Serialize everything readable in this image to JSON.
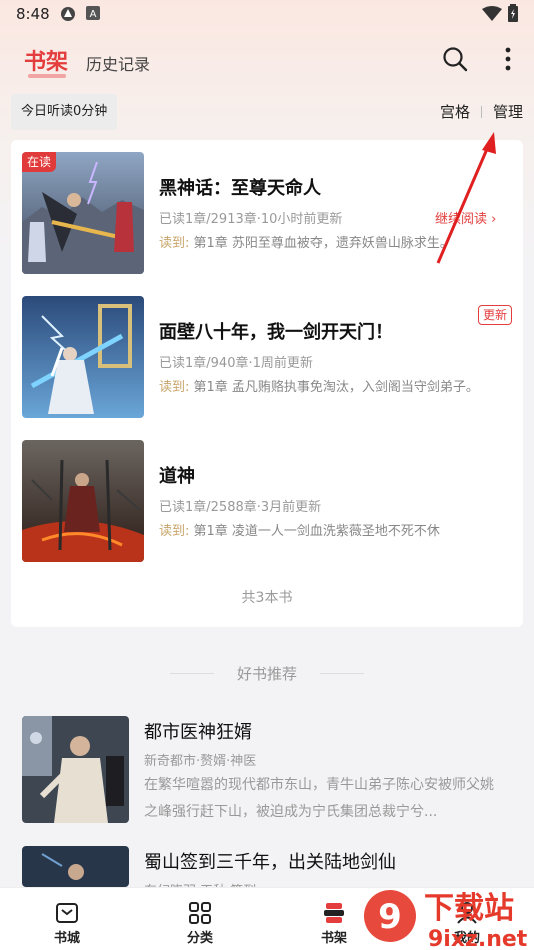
{
  "status_bar": {
    "time": "8:48"
  },
  "header": {
    "tab_active": "书架",
    "tab_history": "历史记录"
  },
  "subbar": {
    "reading_time": "今日听读0分钟",
    "grid_label": "宫格",
    "manage_label": "管理"
  },
  "shelf": {
    "reading_badge": "在读",
    "update_badge": "更新",
    "read_prefix": "读到:",
    "continue_label": "继续阅读 ›",
    "books": [
      {
        "title": "黑神话：至尊天命人",
        "meta": "已读1章/2913章·10小时前更新",
        "last": "第1章 苏阳至尊血被夺，遗弃妖兽山脉求生。"
      },
      {
        "title": "面壁八十年，我一剑开天门！",
        "meta": "已读1章/940章·1周前更新",
        "last": "第1章 孟凡贿赂执事免淘汰，入剑阁当守剑弟子。"
      },
      {
        "title": "道神",
        "meta": "已读1章/2588章·3月前更新",
        "last": "第1章 凌道一人一剑血洗紫薇圣地不死不休"
      }
    ],
    "total": "共3本书"
  },
  "recommend": {
    "heading": "好书推荐",
    "items": [
      {
        "name": "都市医神狂婿",
        "tags": "新奇都市·赘婿·神医",
        "desc": "在繁华喧嚣的现代都市东山，青牛山弟子陈心安被师父姚之峰强行赶下山，被迫成为宁氏集团总裁宁兮..."
      },
      {
        "name": "蜀山签到三千年，出关陆地剑仙",
        "tags": "东幻晓羽·天秋·签到",
        "desc": ""
      }
    ]
  },
  "bottom_nav": [
    {
      "label": "书城",
      "icon": "bookstore-icon"
    },
    {
      "label": "分类",
      "icon": "category-icon"
    },
    {
      "label": "书架",
      "icon": "bookshelf-icon"
    },
    {
      "label": "我的",
      "icon": "profile-icon"
    }
  ],
  "watermark": {
    "brand": "下载站",
    "domain": "9ixz.net"
  },
  "colors": {
    "accent": "#e33d3d",
    "gold_label": "#c8a46a",
    "annotation_arrow": "#e02020"
  }
}
